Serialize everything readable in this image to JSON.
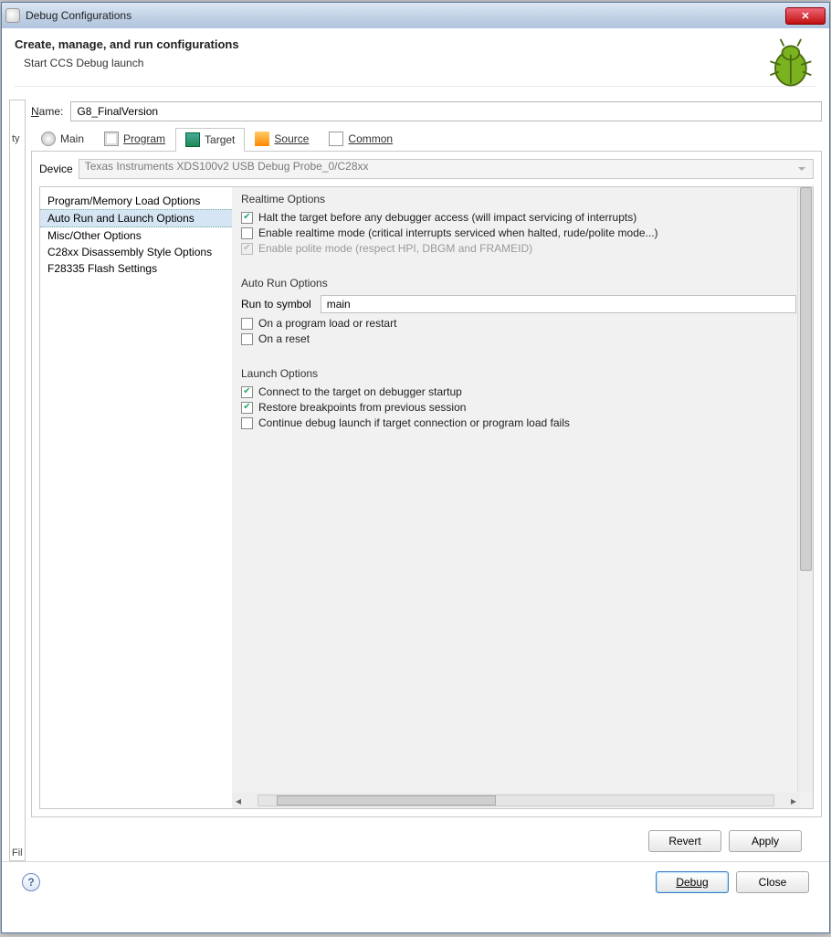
{
  "titlebar": {
    "title": "Debug Configurations"
  },
  "header": {
    "title": "Create, manage, and run configurations",
    "subtitle": "Start CCS Debug launch"
  },
  "name": {
    "label_rest": "ame:",
    "value": "G8_FinalVersion"
  },
  "tabs": {
    "main": "Main",
    "program": "Program",
    "target": "Target",
    "source": "Source",
    "common": "Common"
  },
  "device": {
    "label": "Device",
    "value": "Texas Instruments XDS100v2 USB Debug Probe_0/C28xx"
  },
  "side_items": [
    "Program/Memory Load Options",
    "Auto Run and Launch Options",
    "Misc/Other Options",
    "C28xx Disassembly Style Options",
    "F28335 Flash Settings"
  ],
  "realtime": {
    "title": "Realtime Options",
    "halt": "Halt the target before any debugger access (will impact servicing of interrupts)",
    "enable_rt": "Enable realtime mode (critical interrupts serviced when halted, rude/polite mode...)",
    "polite": "Enable polite mode (respect HPI, DBGM and FRAMEID)"
  },
  "autorun": {
    "title": "Auto Run Options",
    "run_to_label": "Run to symbol",
    "run_to_value": "main",
    "on_load": "On a program load or restart",
    "on_reset": "On a reset"
  },
  "launch": {
    "title": "Launch Options",
    "connect": "Connect to the target on debugger startup",
    "restore_bp": "Restore breakpoints from previous session",
    "continue_fail": "Continue debug launch if target connection or program load fails"
  },
  "buttons": {
    "revert": "Revert",
    "apply": "Apply",
    "debug": "Debug",
    "close": "Close"
  },
  "leftcol": {
    "top": "ty",
    "bottom": "Fil"
  }
}
